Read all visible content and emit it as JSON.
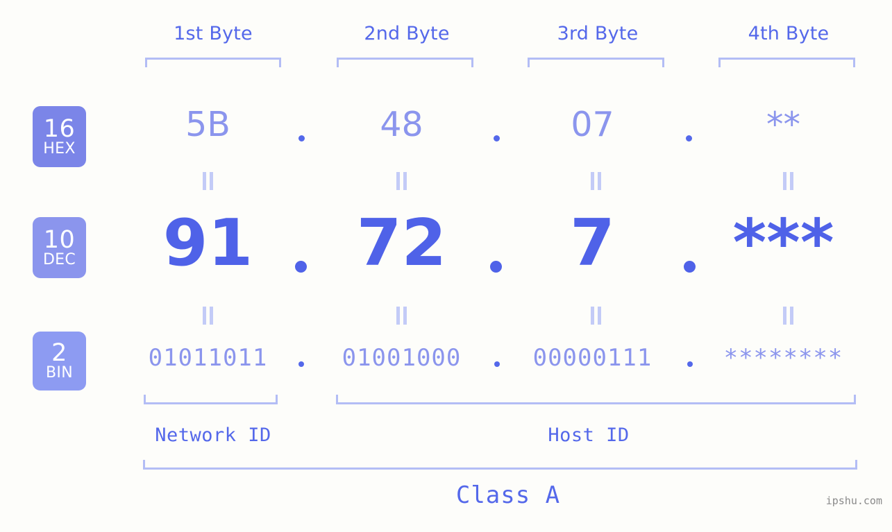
{
  "background_color": "#fdfdfa",
  "accent_colors": {
    "strong_blue": "#4f62e8",
    "label_blue": "#5468ea",
    "light_periwinkle": "#8b95ed",
    "bracket": "#b3bdf5",
    "eq_mark": "#c3cbf7",
    "badge_hex": "#7b85e8",
    "badge_dec": "#8b95ed",
    "badge_bin": "#8d9bf2",
    "watermark": "#8a8a8a"
  },
  "column_headers": [
    {
      "label": "1st Byte"
    },
    {
      "label": "2nd Byte"
    },
    {
      "label": "3rd Byte"
    },
    {
      "label": "4th Byte"
    }
  ],
  "rows": [
    {
      "badge_number": "16",
      "badge_name": "HEX",
      "values": [
        "5B",
        "48",
        "07",
        "**"
      ],
      "separator": "."
    },
    {
      "badge_number": "10",
      "badge_name": "DEC",
      "values": [
        "91",
        "72",
        "7",
        "***"
      ],
      "separator": "."
    },
    {
      "badge_number": "2",
      "badge_name": "BIN",
      "values": [
        "01011011",
        "01001000",
        "00000111",
        "********"
      ],
      "separator": "."
    }
  ],
  "equality_symbol": "||",
  "segments": {
    "network_id": "Network ID",
    "host_id": "Host ID"
  },
  "class_label": "Class A",
  "watermark": "ipshu.com"
}
